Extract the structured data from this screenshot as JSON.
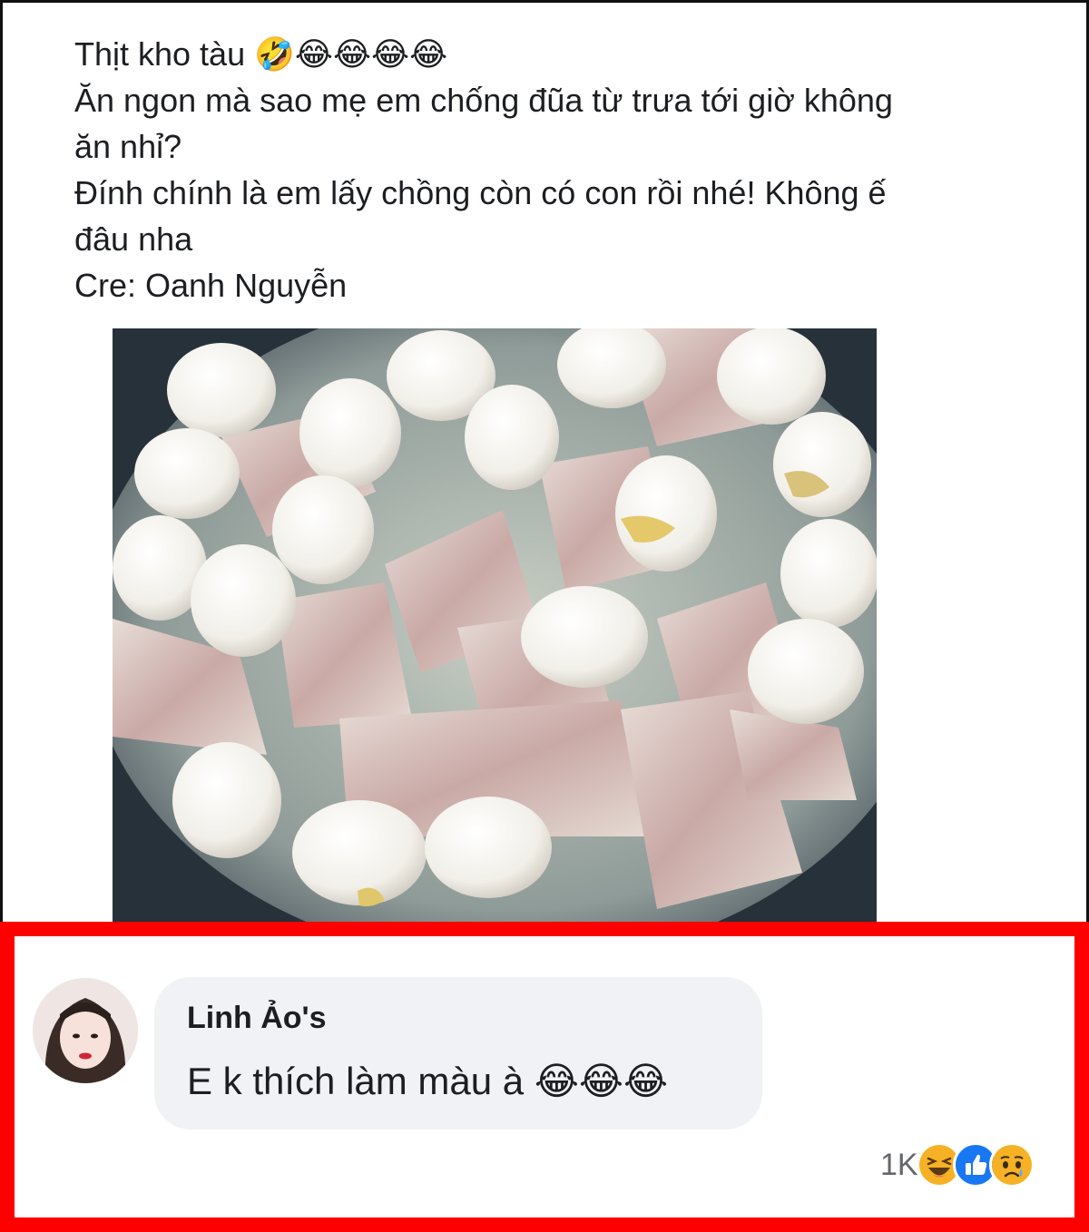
{
  "post": {
    "lines": [
      "Thịt kho tàu 🤣😂😂😂😂",
      "Ăn ngon mà sao mẹ em chống đũa từ trưa tới giờ không",
      "ăn nhỉ?",
      "Đính chính là em lấy chồng còn có con rồi nhé! Không ế",
      "đâu nha",
      "Cre: Oanh Nguyễn"
    ]
  },
  "comment": {
    "author": "Linh Ảo's",
    "text": "E k thích làm màu à 😂😂😂",
    "reaction_count": "1K",
    "reactions": [
      "haha-icon",
      "like-icon",
      "sad-icon"
    ]
  },
  "colors": {
    "highlight_border": "#ff0000",
    "bubble_bg": "#f0f2f5",
    "like_blue": "#1877f2",
    "reaction_yellow": "#f7b125"
  }
}
